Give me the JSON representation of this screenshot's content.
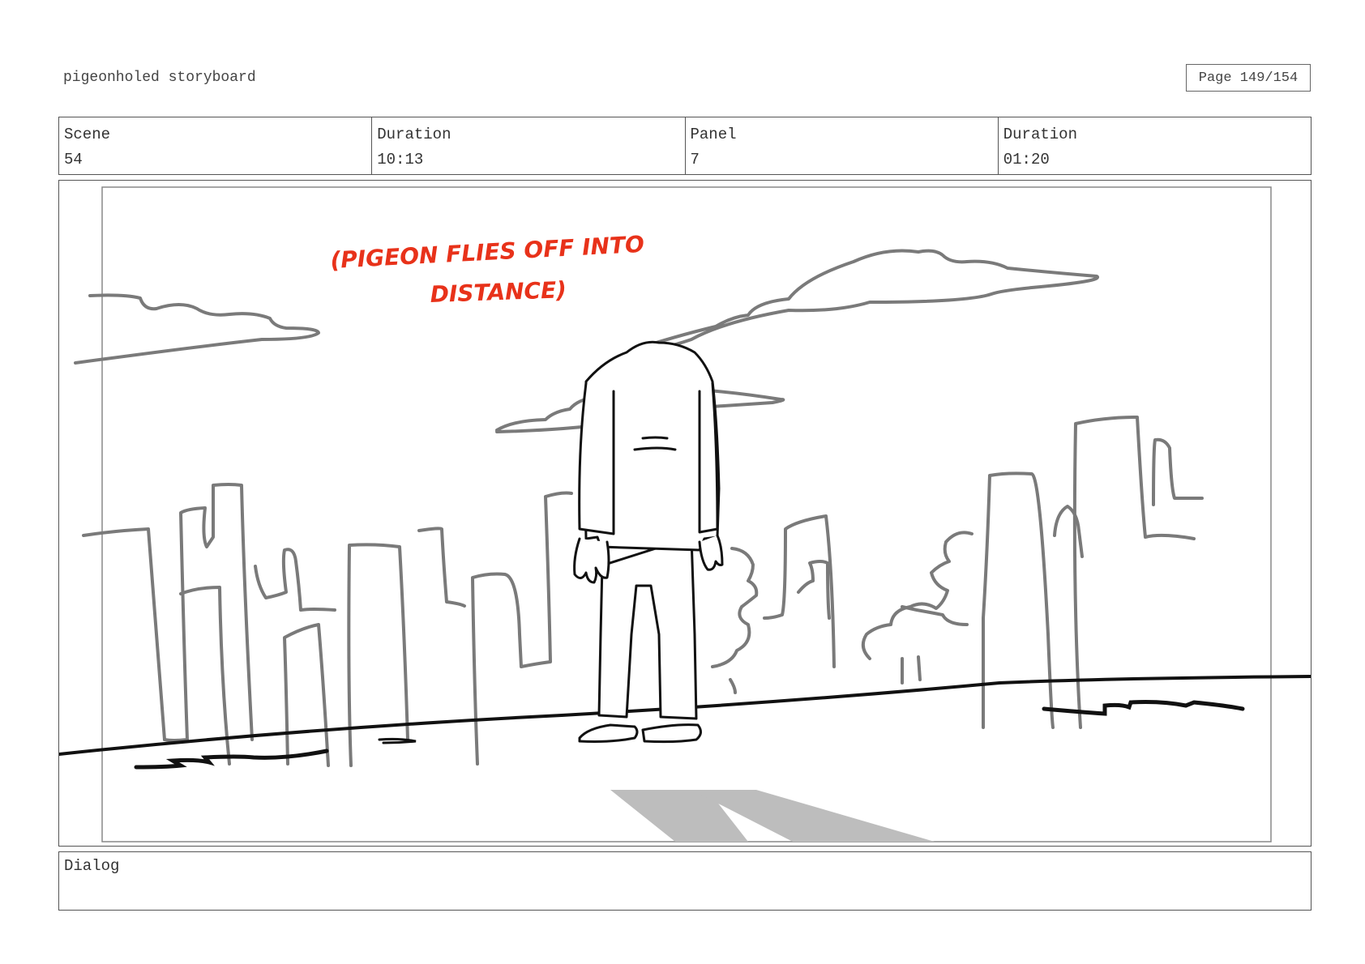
{
  "header": {
    "title": "pigeonholed storyboard",
    "page_label": "Page 149/154"
  },
  "info": {
    "scene_label": "Scene",
    "scene_value": "54",
    "duration_label": "Duration",
    "duration_value": "10:13",
    "panel_label": "Panel",
    "panel_value": "7",
    "panel_duration_label": "Duration",
    "panel_duration_value": "01:20"
  },
  "panel": {
    "annotation_line1": "(PIGEON FLIES OFF INTO",
    "annotation_line2": "DISTANCE)",
    "annotation_color": "#e8321a"
  },
  "dialog": {
    "label": "Dialog",
    "text": ""
  }
}
